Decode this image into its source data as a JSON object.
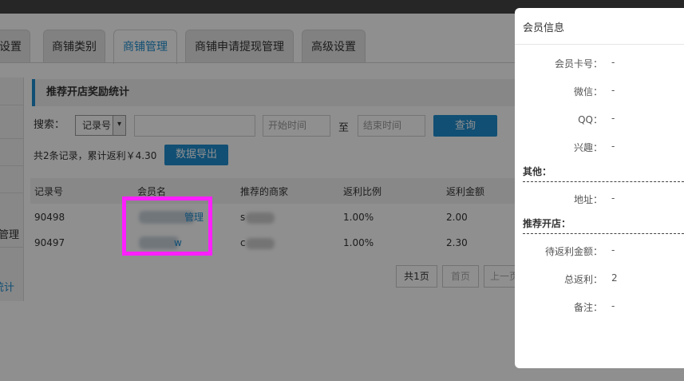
{
  "tabs": [
    {
      "label": "设置",
      "active": false
    },
    {
      "label": "商铺类别",
      "active": false
    },
    {
      "label": "商铺管理",
      "active": true
    },
    {
      "label": "商铺申请提现管理",
      "active": false
    },
    {
      "label": "高级设置",
      "active": false
    }
  ],
  "sidebar": {
    "items": [
      {
        "label": "管理"
      },
      {
        "label": "统计"
      }
    ]
  },
  "panel": {
    "title": "推荐开店奖励统计"
  },
  "search": {
    "label": "搜索：",
    "field_select": "记录号",
    "keyword_value": "",
    "start_placeholder": "开始时间",
    "to_label": "至",
    "end_placeholder": "结束时间",
    "query_button": "查询"
  },
  "summary": {
    "text": "共2条记录，累计返利￥4.30",
    "export_button": "数据导出"
  },
  "table": {
    "headers": [
      "记录号",
      "会员名",
      "推荐的商家",
      "返利比例",
      "返利金额"
    ],
    "rows": [
      {
        "id": "90498",
        "member_visible": "管理",
        "merchant_visible": "s",
        "ratio": "1.00%",
        "amount": "2.00"
      },
      {
        "id": "90497",
        "member_visible": "w",
        "merchant_visible": "c",
        "ratio": "1.00%",
        "amount": "2.30"
      }
    ]
  },
  "pagination": {
    "total_pages": "共1页",
    "first": "首页",
    "prev": "上一页"
  },
  "drawer": {
    "title": "会员信息",
    "rows_top": [
      {
        "label": "会员卡号：",
        "value": "-"
      },
      {
        "label": "微信：",
        "value": "-"
      },
      {
        "label": "QQ：",
        "value": "-"
      },
      {
        "label": "兴趣：",
        "value": "-"
      }
    ],
    "section_other": "其他：",
    "rows_other": [
      {
        "label": "地址：",
        "value": "-"
      }
    ],
    "section_shop": "推荐开店：",
    "rows_shop": [
      {
        "label": "待返利金额：",
        "value": "-"
      },
      {
        "label": "总返利：",
        "value": "2"
      },
      {
        "label": "备注：",
        "value": "-"
      }
    ]
  },
  "colors": {
    "accent": "#1f8ecf",
    "highlight": "#ff1fff",
    "topbar": "#262626"
  }
}
